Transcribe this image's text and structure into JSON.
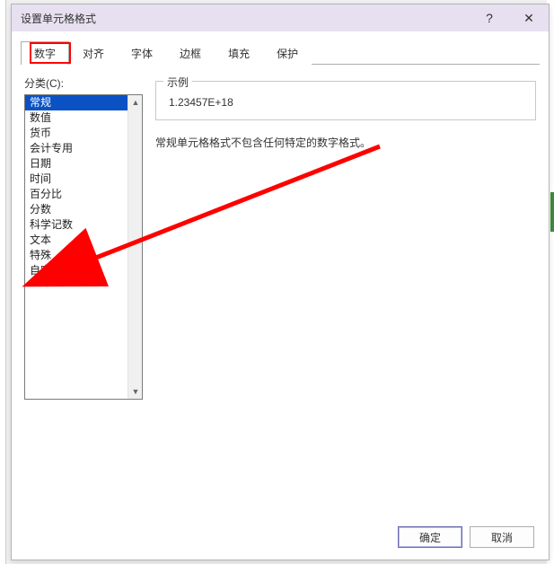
{
  "window": {
    "title": "设置单元格格式",
    "help_icon": "?",
    "close_icon": "✕"
  },
  "tabs": [
    {
      "label": "数字",
      "active": true
    },
    {
      "label": "对齐",
      "active": false
    },
    {
      "label": "字体",
      "active": false
    },
    {
      "label": "边框",
      "active": false
    },
    {
      "label": "填充",
      "active": false
    },
    {
      "label": "保护",
      "active": false
    }
  ],
  "category": {
    "label": "分类(C):",
    "items": [
      {
        "label": "常规",
        "selected": true
      },
      {
        "label": "数值"
      },
      {
        "label": "货币"
      },
      {
        "label": "会计专用"
      },
      {
        "label": "日期"
      },
      {
        "label": "时间"
      },
      {
        "label": "百分比"
      },
      {
        "label": "分数"
      },
      {
        "label": "科学记数"
      },
      {
        "label": "文本"
      },
      {
        "label": "特殊"
      },
      {
        "label": "自定义"
      }
    ]
  },
  "sample": {
    "label": "示例",
    "value": "1.23457E+18"
  },
  "description": "常规单元格格式不包含任何特定的数字格式。",
  "buttons": {
    "ok": "确定",
    "cancel": "取消"
  },
  "scrollbar": {
    "up": "▲",
    "down": "▼"
  },
  "colors": {
    "highlight": "#ff0000",
    "selection": "#0a52c4",
    "titlebar": "#e6e0f0"
  }
}
